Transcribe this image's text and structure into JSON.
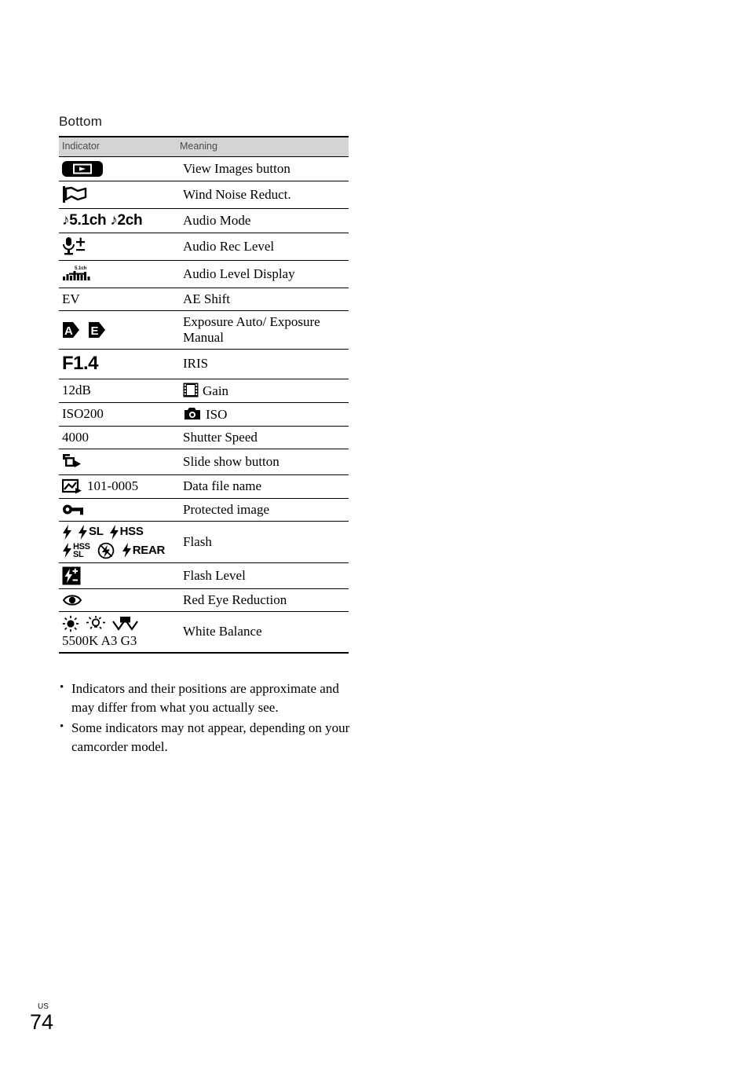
{
  "page": {
    "section_heading": "Bottom",
    "folio_region": "US",
    "folio_number": "74"
  },
  "table": {
    "columns": [
      "Indicator",
      "Meaning"
    ],
    "rows": [
      {
        "indicator_icons": [
          "view-images-button-icon"
        ],
        "indicator_text": "",
        "meaning": "View Images button",
        "meaning_icon": ""
      },
      {
        "indicator_icons": [
          "wind-noise-flag-icon"
        ],
        "indicator_text": "",
        "meaning": "Wind Noise Reduct.",
        "meaning_icon": ""
      },
      {
        "indicator_icons": [
          "music-note-icon",
          "music-note-icon"
        ],
        "indicator_text": "♪5.1ch ♪2ch",
        "meaning": "Audio Mode",
        "meaning_icon": ""
      },
      {
        "indicator_icons": [
          "microphone-icon",
          "plus-minus-icon"
        ],
        "indicator_text": "",
        "meaning": "Audio Rec Level",
        "meaning_icon": ""
      },
      {
        "indicator_icons": [
          "audio-level-meter-icon"
        ],
        "indicator_text": "",
        "meaning": "Audio Level Display",
        "meaning_icon": ""
      },
      {
        "indicator_icons": [],
        "indicator_text": "EV",
        "meaning": "AE Shift",
        "meaning_icon": ""
      },
      {
        "indicator_icons": [
          "exposure-auto-icon",
          "exposure-manual-icon"
        ],
        "indicator_text": "",
        "meaning": "Exposure Auto/ Exposure Manual",
        "meaning_icon": ""
      },
      {
        "indicator_icons": [],
        "indicator_text": "F1.4",
        "meaning": "IRIS",
        "meaning_icon": ""
      },
      {
        "indicator_icons": [],
        "indicator_text": "12dB",
        "meaning": "Gain",
        "meaning_icon": "film-frame-icon"
      },
      {
        "indicator_icons": [],
        "indicator_text": "ISO200",
        "meaning": "ISO",
        "meaning_icon": "camera-icon"
      },
      {
        "indicator_icons": [],
        "indicator_text": "4000",
        "meaning": "Shutter Speed",
        "meaning_icon": ""
      },
      {
        "indicator_icons": [
          "slide-show-icon"
        ],
        "indicator_text": "",
        "meaning": "Slide show button",
        "meaning_icon": ""
      },
      {
        "indicator_icons": [
          "picture-file-icon"
        ],
        "indicator_text": "101-0005",
        "meaning": "Data file name",
        "meaning_icon": ""
      },
      {
        "indicator_icons": [
          "key-icon"
        ],
        "indicator_text": "",
        "meaning": "Protected image",
        "meaning_icon": ""
      },
      {
        "indicator_icons": [
          "flash-icon",
          "flash-sl-icon",
          "flash-hss-icon",
          "flash-hss-sl-icon",
          "flash-off-icon",
          "flash-rear-icon"
        ],
        "indicator_text": "",
        "meaning": "Flash",
        "meaning_icon": ""
      },
      {
        "indicator_icons": [
          "flash-level-icon"
        ],
        "indicator_text": "",
        "meaning": "Flash Level",
        "meaning_icon": ""
      },
      {
        "indicator_icons": [
          "red-eye-icon"
        ],
        "indicator_text": "",
        "meaning": "Red Eye Reduction",
        "meaning_icon": ""
      },
      {
        "indicator_icons": [
          "sun-icon",
          "incandescent-bulb-icon",
          "one-push-wb-icon"
        ],
        "indicator_text": "5500K  A3  G3",
        "meaning": "White Balance",
        "meaning_icon": ""
      }
    ]
  },
  "flash_labels": {
    "sl": "SL",
    "hss": "HSS",
    "hss_top": "HSS",
    "sl_bottom": "SL",
    "rear": "REAR"
  },
  "audio": {
    "mode_5_1": "♪5.1ch",
    "mode_2ch": "♪2ch",
    "level_meter_caption": "5.1ch"
  },
  "white_balance": {
    "values": "5500K  A3  G3"
  },
  "notes": [
    "Indicators and their positions are approximate and may differ from what you actually see.",
    "Some indicators may not appear, depending on your camcorder model."
  ],
  "colors": {
    "header_band": "#d4d4d4",
    "header_text": "#4a4a4a",
    "rule": "#000000",
    "body_text": "#000000"
  }
}
